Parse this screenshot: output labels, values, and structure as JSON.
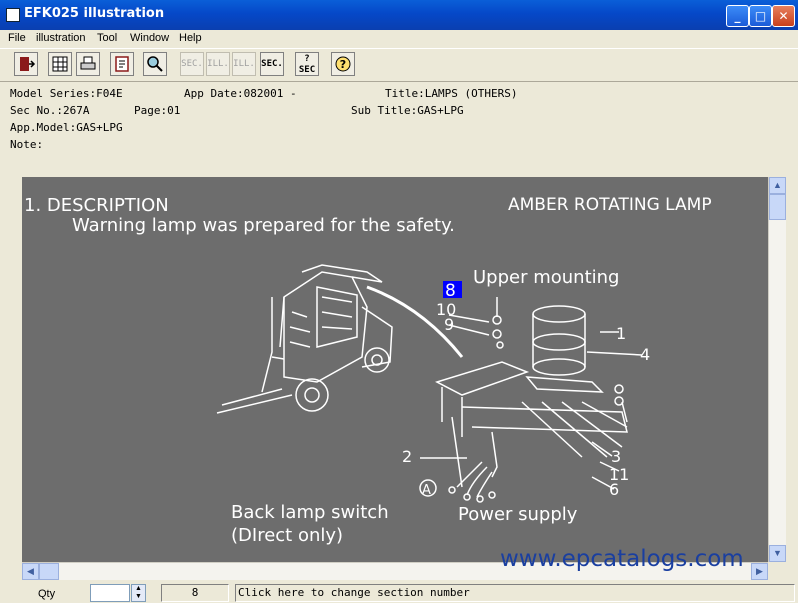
{
  "window": {
    "title": "EFK025 illustration"
  },
  "menu": [
    "File",
    "illustration",
    "Tool",
    "Window",
    "Help"
  ],
  "toolbar": {
    "sec_prev": "SEC.",
    "ill_prev": "ILL.",
    "ill_next": "ILL.",
    "sec_next": "SEC.",
    "sec_query": "SEC",
    "sec_query_mark": "?"
  },
  "info": {
    "model_series": "Model Series:F04E",
    "app_date": "App Date:082001 -",
    "title": "Title:LAMPS (OTHERS)",
    "sec_no": "Sec No.:267A",
    "page": "Page:01",
    "sub_title": "Sub Title:GAS+LPG",
    "app_model": "App.Model:GAS+LPG",
    "note": "Note:"
  },
  "illustration": {
    "description_heading": "1. DESCRIPTION",
    "lamp_title": "AMBER ROTATING LAMP",
    "description_text": "Warning lamp was prepared for the safety.",
    "upper_mounting": "Upper mounting",
    "callout_selected": "8",
    "callouts": [
      "10",
      "9",
      "1",
      "4",
      "2",
      "3",
      "11",
      "6"
    ],
    "connector_label": "A",
    "back_lamp_switch": "Back lamp switch",
    "direct_only": "(DIrect only)",
    "power_supply": "Power supply"
  },
  "statusbar": {
    "qty_label": "Qty",
    "qty_value": "",
    "section_value": "8",
    "hint": "Click here to change section number"
  },
  "watermark": "www.epcatalogs.com",
  "colors": {
    "title_bar": "#0A5FD8",
    "canvas": "#6D6D6D",
    "selected_callout": "#0000FF",
    "watermark": "#1A3FA0"
  }
}
